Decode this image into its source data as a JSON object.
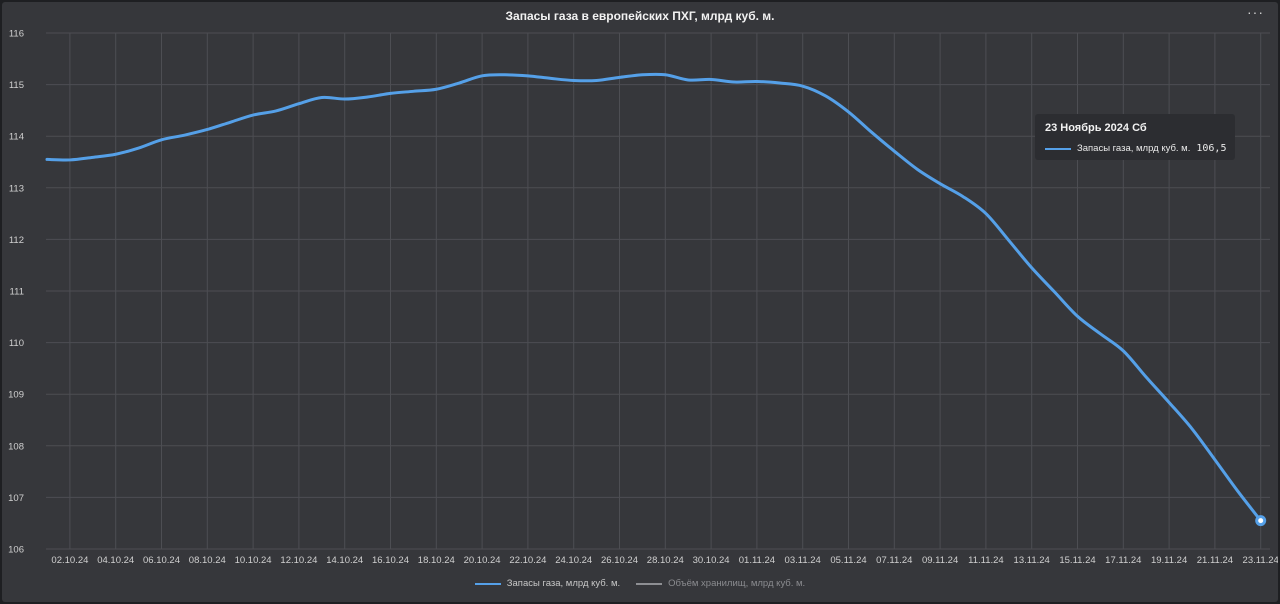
{
  "chart_data": {
    "type": "line",
    "title": "Запасы газа в европейских ПХГ, млрд куб. м.",
    "xlabel": "",
    "ylabel": "",
    "ylim": [
      106,
      116
    ],
    "yticks": [
      106,
      107,
      108,
      109,
      110,
      111,
      112,
      113,
      114,
      115,
      116
    ],
    "x_tick_labels": [
      "02.10.24",
      "04.10.24",
      "06.10.24",
      "08.10.24",
      "10.10.24",
      "12.10.24",
      "14.10.24",
      "16.10.24",
      "18.10.24",
      "20.10.24",
      "22.10.24",
      "24.10.24",
      "26.10.24",
      "28.10.24",
      "30.10.24",
      "01.11.24",
      "03.11.24",
      "05.11.24",
      "07.11.24",
      "09.11.24",
      "11.11.24",
      "13.11.24",
      "15.11.24",
      "17.11.24",
      "19.11.24",
      "21.11.24",
      "23.11.24"
    ],
    "grid": true,
    "legend_position": "bottom",
    "series": [
      {
        "name": "Запасы газа, млрд куб. м.",
        "color": "#55a0e8",
        "values": [
          113.55,
          113.54,
          113.59,
          113.65,
          113.77,
          113.93,
          114.02,
          114.13,
          114.27,
          114.41,
          114.49,
          114.63,
          114.75,
          114.72,
          114.76,
          114.83,
          114.87,
          114.91,
          115.03,
          115.17,
          115.19,
          115.17,
          115.12,
          115.08,
          115.08,
          115.14,
          115.19,
          115.19,
          115.09,
          115.1,
          115.05,
          115.06,
          115.03,
          114.97,
          114.78,
          114.47,
          114.08,
          113.71,
          113.36,
          113.08,
          112.83,
          112.5,
          111.98,
          111.45,
          110.98,
          110.51,
          110.17,
          109.84,
          109.33,
          108.84,
          108.33,
          107.73,
          107.12,
          106.55
        ]
      },
      {
        "name": "Объём хранилищ, млрд куб. м.",
        "color": "#8e8f93",
        "values": []
      }
    ]
  },
  "tooltip": {
    "date": "23 Ноябрь 2024 Сб",
    "series_name": "Запасы газа, млрд куб. м.",
    "value": "106,5"
  },
  "menu_label": "···"
}
